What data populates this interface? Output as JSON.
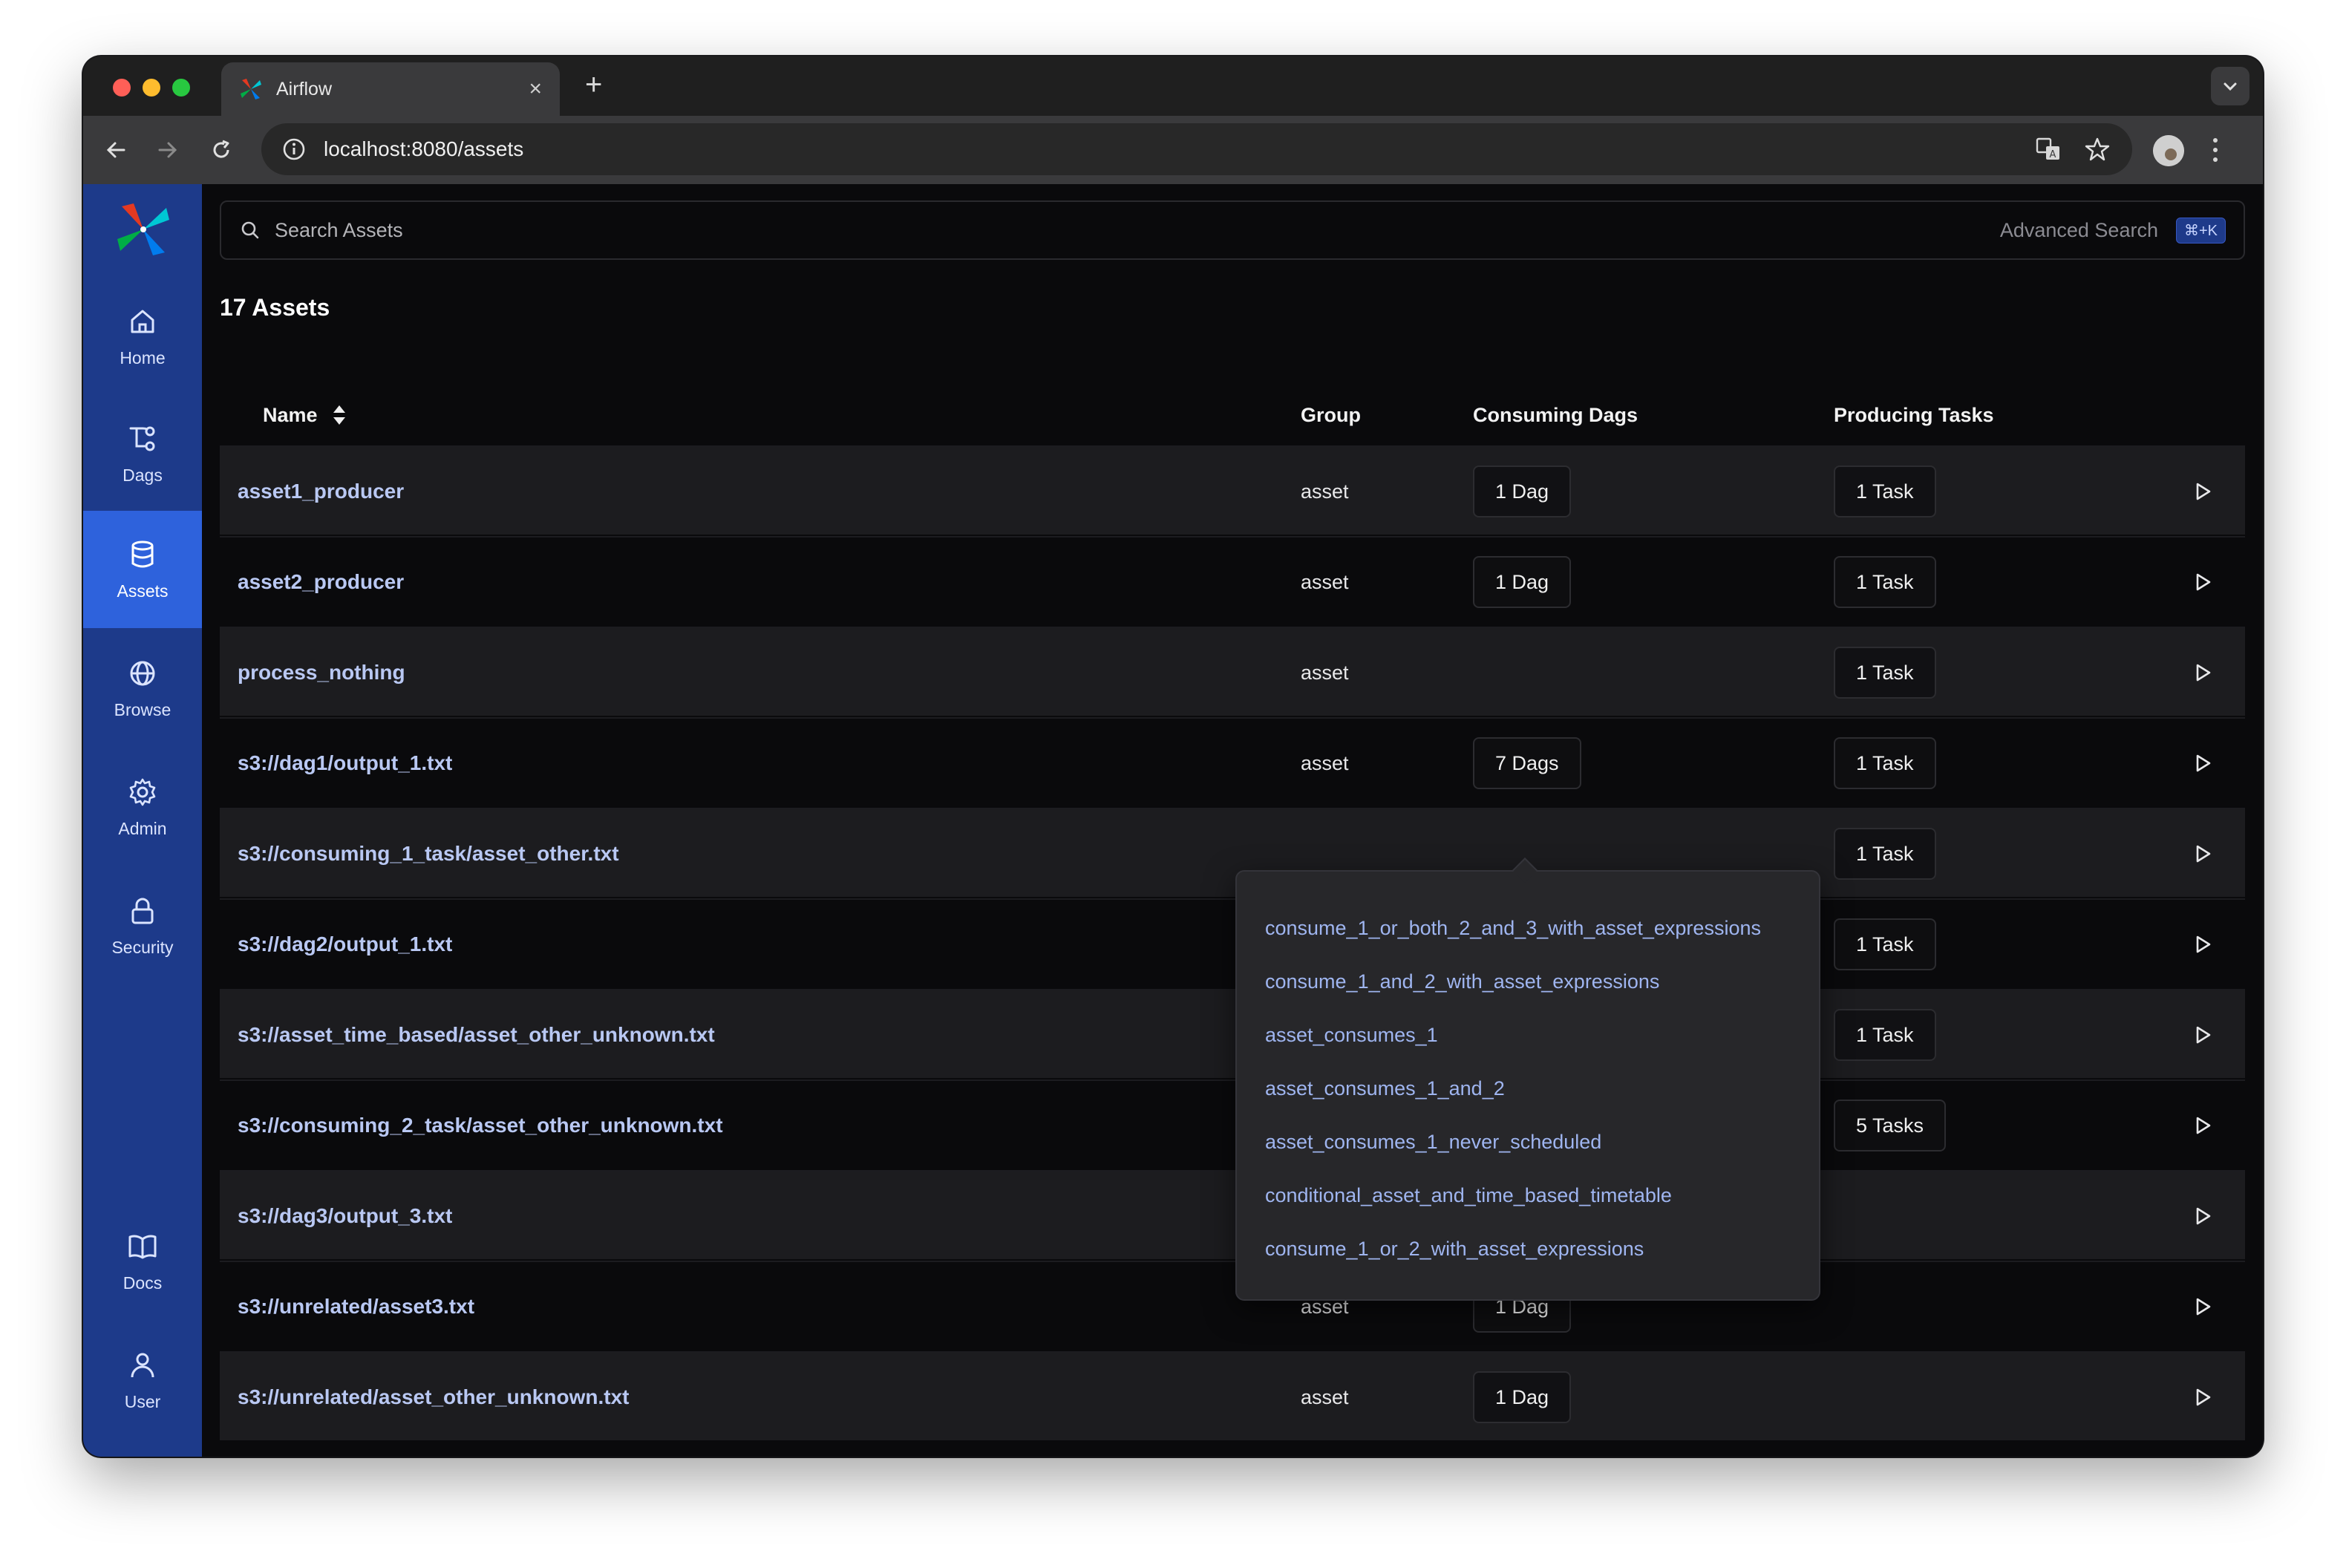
{
  "browser": {
    "tab_title": "Airflow",
    "url": "localhost:8080/assets"
  },
  "sidebar": {
    "top_items": [
      {
        "label": "Home",
        "icon": "home-icon"
      },
      {
        "label": "Dags",
        "icon": "dags-icon"
      },
      {
        "label": "Assets",
        "icon": "database-icon",
        "active": true
      },
      {
        "label": "Browse",
        "icon": "globe-icon"
      },
      {
        "label": "Admin",
        "icon": "gear-icon"
      },
      {
        "label": "Security",
        "icon": "lock-icon"
      }
    ],
    "bottom_items": [
      {
        "label": "Docs",
        "icon": "book-icon"
      },
      {
        "label": "User",
        "icon": "user-icon"
      }
    ]
  },
  "search": {
    "placeholder": "Search Assets",
    "advanced_label": "Advanced Search",
    "shortcut": "⌘+K"
  },
  "page": {
    "title": "17 Assets"
  },
  "table": {
    "headers": {
      "name": "Name",
      "group": "Group",
      "consuming": "Consuming Dags",
      "producing": "Producing Tasks"
    },
    "rows": [
      {
        "name": "asset1_producer",
        "group": "asset",
        "consuming": "1 Dag",
        "producing": "1 Task"
      },
      {
        "name": "asset2_producer",
        "group": "asset",
        "consuming": "1 Dag",
        "producing": "1 Task"
      },
      {
        "name": "process_nothing",
        "group": "asset",
        "consuming": "",
        "producing": "1 Task"
      },
      {
        "name": "s3://dag1/output_1.txt",
        "group": "asset",
        "consuming": "7 Dags",
        "producing": "1 Task"
      },
      {
        "name": "s3://consuming_1_task/asset_other.txt",
        "group": "",
        "consuming": "",
        "producing": "1 Task"
      },
      {
        "name": "s3://dag2/output_1.txt",
        "group": "",
        "consuming": "",
        "producing": "1 Task"
      },
      {
        "name": "s3://asset_time_based/asset_other_unknown.txt",
        "group": "",
        "consuming": "",
        "producing": "1 Task"
      },
      {
        "name": "s3://consuming_2_task/asset_other_unknown.txt",
        "group": "",
        "consuming": "",
        "producing": "5 Tasks"
      },
      {
        "name": "s3://dag3/output_3.txt",
        "group": "",
        "consuming": "",
        "producing": ""
      },
      {
        "name": "s3://unrelated/asset3.txt",
        "group": "asset",
        "consuming": "1 Dag",
        "producing": ""
      },
      {
        "name": "s3://unrelated/asset_other_unknown.txt",
        "group": "asset",
        "consuming": "1 Dag",
        "producing": ""
      }
    ]
  },
  "popover": {
    "items": [
      "consume_1_or_both_2_and_3_with_asset_expressions",
      "consume_1_and_2_with_asset_expressions",
      "asset_consumes_1",
      "asset_consumes_1_and_2",
      "asset_consumes_1_never_scheduled",
      "conditional_asset_and_time_based_timetable",
      "consume_1_or_2_with_asset_expressions"
    ]
  },
  "colors": {
    "sidebar": "#1d3a8a",
    "sidebar_active": "#2e62dc",
    "link": "#b9c8f3",
    "popover_link": "#9fb5f0"
  }
}
